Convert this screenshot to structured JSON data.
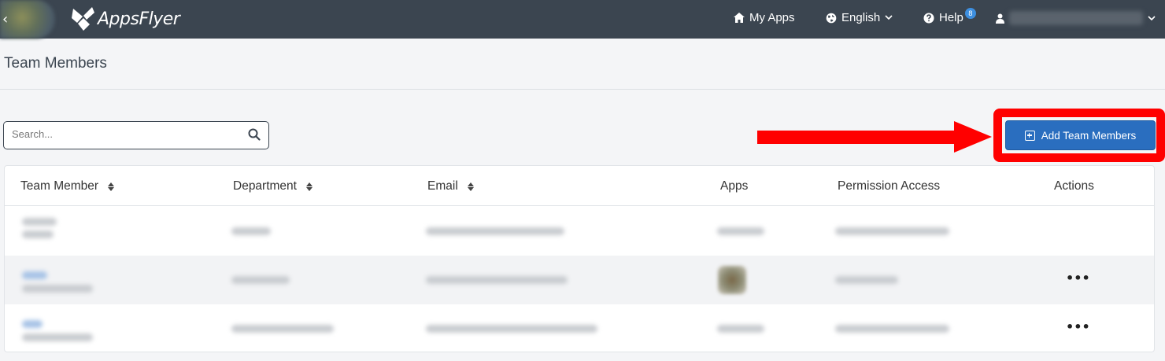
{
  "header": {
    "logo_text": "AppsFlyer",
    "back_glyph": "‹",
    "nav": {
      "my_apps": "My Apps",
      "language": "English",
      "help": "Help",
      "help_badge": "8"
    },
    "icons": {
      "home": "home-icon",
      "globe": "globe-icon",
      "help": "question-circle-icon",
      "user": "user-icon",
      "chevron": "chevron-down-icon"
    }
  },
  "page": {
    "title": "Team Members"
  },
  "search": {
    "placeholder": "Search...",
    "value": ""
  },
  "toolbar": {
    "add_label": "Add Team Members"
  },
  "table": {
    "columns": [
      "Team Member",
      "Department",
      "Email",
      "Apps",
      "Permission Access",
      "Actions"
    ],
    "actions_glyph": "•••"
  },
  "colors": {
    "topbar": "#3b4550",
    "primary_button": "#2a6ebf",
    "annotation": "#ff0000",
    "badge": "#3d8fe0"
  }
}
